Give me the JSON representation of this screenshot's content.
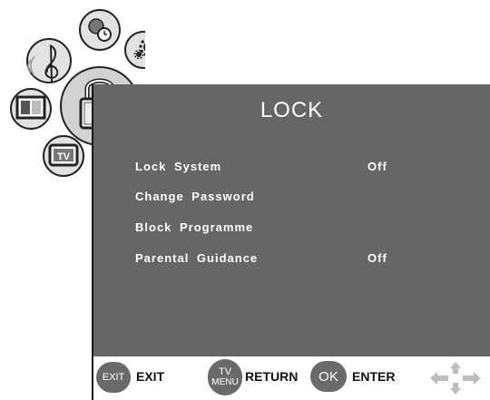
{
  "menu": {
    "title": "LOCK",
    "items": [
      {
        "label": "Lock System",
        "value": "Off"
      },
      {
        "label": "Change Password",
        "value": ""
      },
      {
        "label": "Block Programme",
        "value": ""
      },
      {
        "label": "Parental Guidance",
        "value": "Off"
      }
    ]
  },
  "footer": {
    "exit_badge": "EXIT",
    "exit_label": "EXIT",
    "tv_badge_top": "TV",
    "tv_badge_bottom": "MENU",
    "return_label": "RETURN",
    "ok_badge": "OK",
    "enter_label": "ENTER"
  },
  "tabs": {
    "tv_icon_text": "TV"
  },
  "colors": {
    "panel": "#666666",
    "icon_bg": "#e6e6e6",
    "active_icon_bg": "#d0d0d0"
  }
}
